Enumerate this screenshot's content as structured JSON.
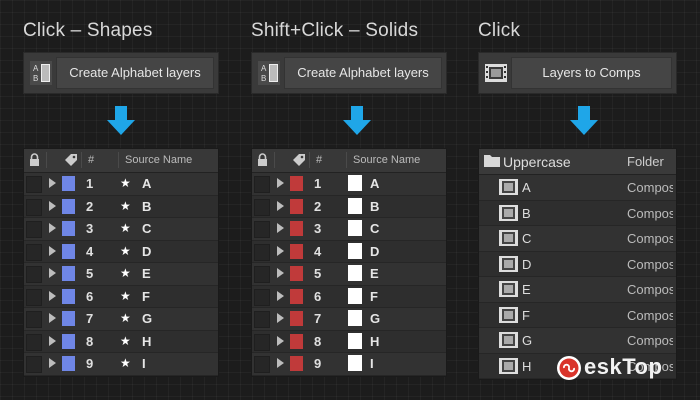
{
  "colors": {
    "accent_arrow": "#1fa6e8",
    "shape_swatch": "#6f86e6",
    "solid_swatch": "#c03a3a"
  },
  "columns": [
    {
      "heading": "Click – Shapes",
      "button_label": "Create Alphabet layers",
      "button_icon": "alphabet-layers-icon",
      "table": {
        "headers": [
          "#",
          "Source Name"
        ],
        "rows": [
          {
            "num": "1",
            "name": "A"
          },
          {
            "num": "2",
            "name": "B"
          },
          {
            "num": "3",
            "name": "C"
          },
          {
            "num": "4",
            "name": "D"
          },
          {
            "num": "5",
            "name": "E"
          },
          {
            "num": "6",
            "name": "F"
          },
          {
            "num": "7",
            "name": "G"
          },
          {
            "num": "8",
            "name": "H"
          },
          {
            "num": "9",
            "name": "I"
          }
        ]
      }
    },
    {
      "heading": "Shift+Click – Solids",
      "button_label": "Create Alphabet layers",
      "button_icon": "alphabet-layers-icon",
      "table": {
        "headers": [
          "#",
          "Source Name"
        ],
        "rows": [
          {
            "num": "1",
            "name": "A"
          },
          {
            "num": "2",
            "name": "B"
          },
          {
            "num": "3",
            "name": "C"
          },
          {
            "num": "4",
            "name": "D"
          },
          {
            "num": "5",
            "name": "E"
          },
          {
            "num": "6",
            "name": "F"
          },
          {
            "num": "7",
            "name": "G"
          },
          {
            "num": "8",
            "name": "H"
          },
          {
            "num": "9",
            "name": "I"
          }
        ]
      }
    },
    {
      "heading": "Click",
      "button_label": "Layers to Comps",
      "button_icon": "film-comp-icon",
      "project": {
        "folder_name": "Uppercase",
        "folder_header": "Folder",
        "items": [
          {
            "name": "A",
            "type": "Compos"
          },
          {
            "name": "B",
            "type": "Compos"
          },
          {
            "name": "C",
            "type": "Compos"
          },
          {
            "name": "D",
            "type": "Compos"
          },
          {
            "name": "E",
            "type": "Compos"
          },
          {
            "name": "F",
            "type": "Compos"
          },
          {
            "name": "G",
            "type": "Compos"
          },
          {
            "name": "H",
            "type": "Compos"
          }
        ]
      }
    }
  ],
  "watermark": {
    "text": "eskTop"
  }
}
